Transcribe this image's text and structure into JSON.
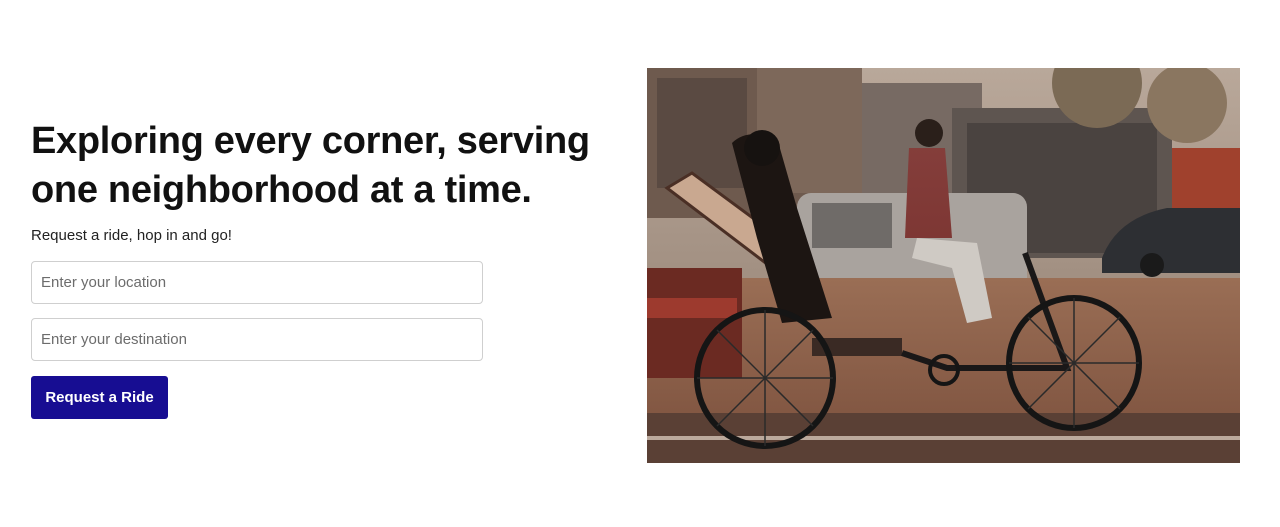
{
  "hero": {
    "headline_line1": "Exploring every corner, serving",
    "headline_line2": "one neighborhood at a time.",
    "subtitle": "Request a ride, hop in and go!"
  },
  "form": {
    "location_placeholder": "Enter your location",
    "destination_placeholder": "Enter your destination",
    "location_value": "",
    "destination_value": "",
    "submit_label": "Request a Ride"
  },
  "colors": {
    "button_bg": "#170d92",
    "button_text": "#ffffff",
    "headline": "#111111"
  }
}
